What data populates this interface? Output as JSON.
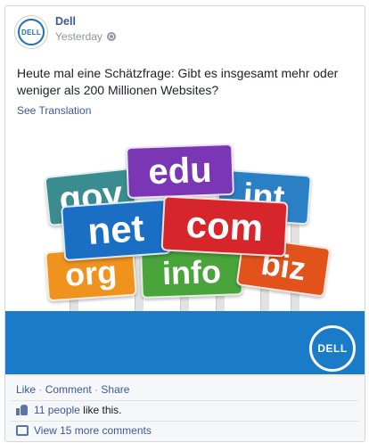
{
  "post": {
    "author": "Dell",
    "avatar_text": "DELL",
    "timestamp": "Yesterday",
    "text": "Heute mal eine Schätzfrage: Gibt es insgesamt mehr oder weniger als 200 Millionen Websites?",
    "see_translation": "See Translation"
  },
  "image": {
    "signs": [
      "gov",
      "edu",
      "int",
      "net",
      "com",
      "org",
      "info",
      "biz"
    ],
    "logo_text": "DELL"
  },
  "actions": {
    "like": "Like",
    "comment": "Comment",
    "share": "Share",
    "separator": "·"
  },
  "likes": {
    "people_link": "11 people",
    "suffix": "like this."
  },
  "comments": {
    "view_more": "View 15 more comments"
  }
}
